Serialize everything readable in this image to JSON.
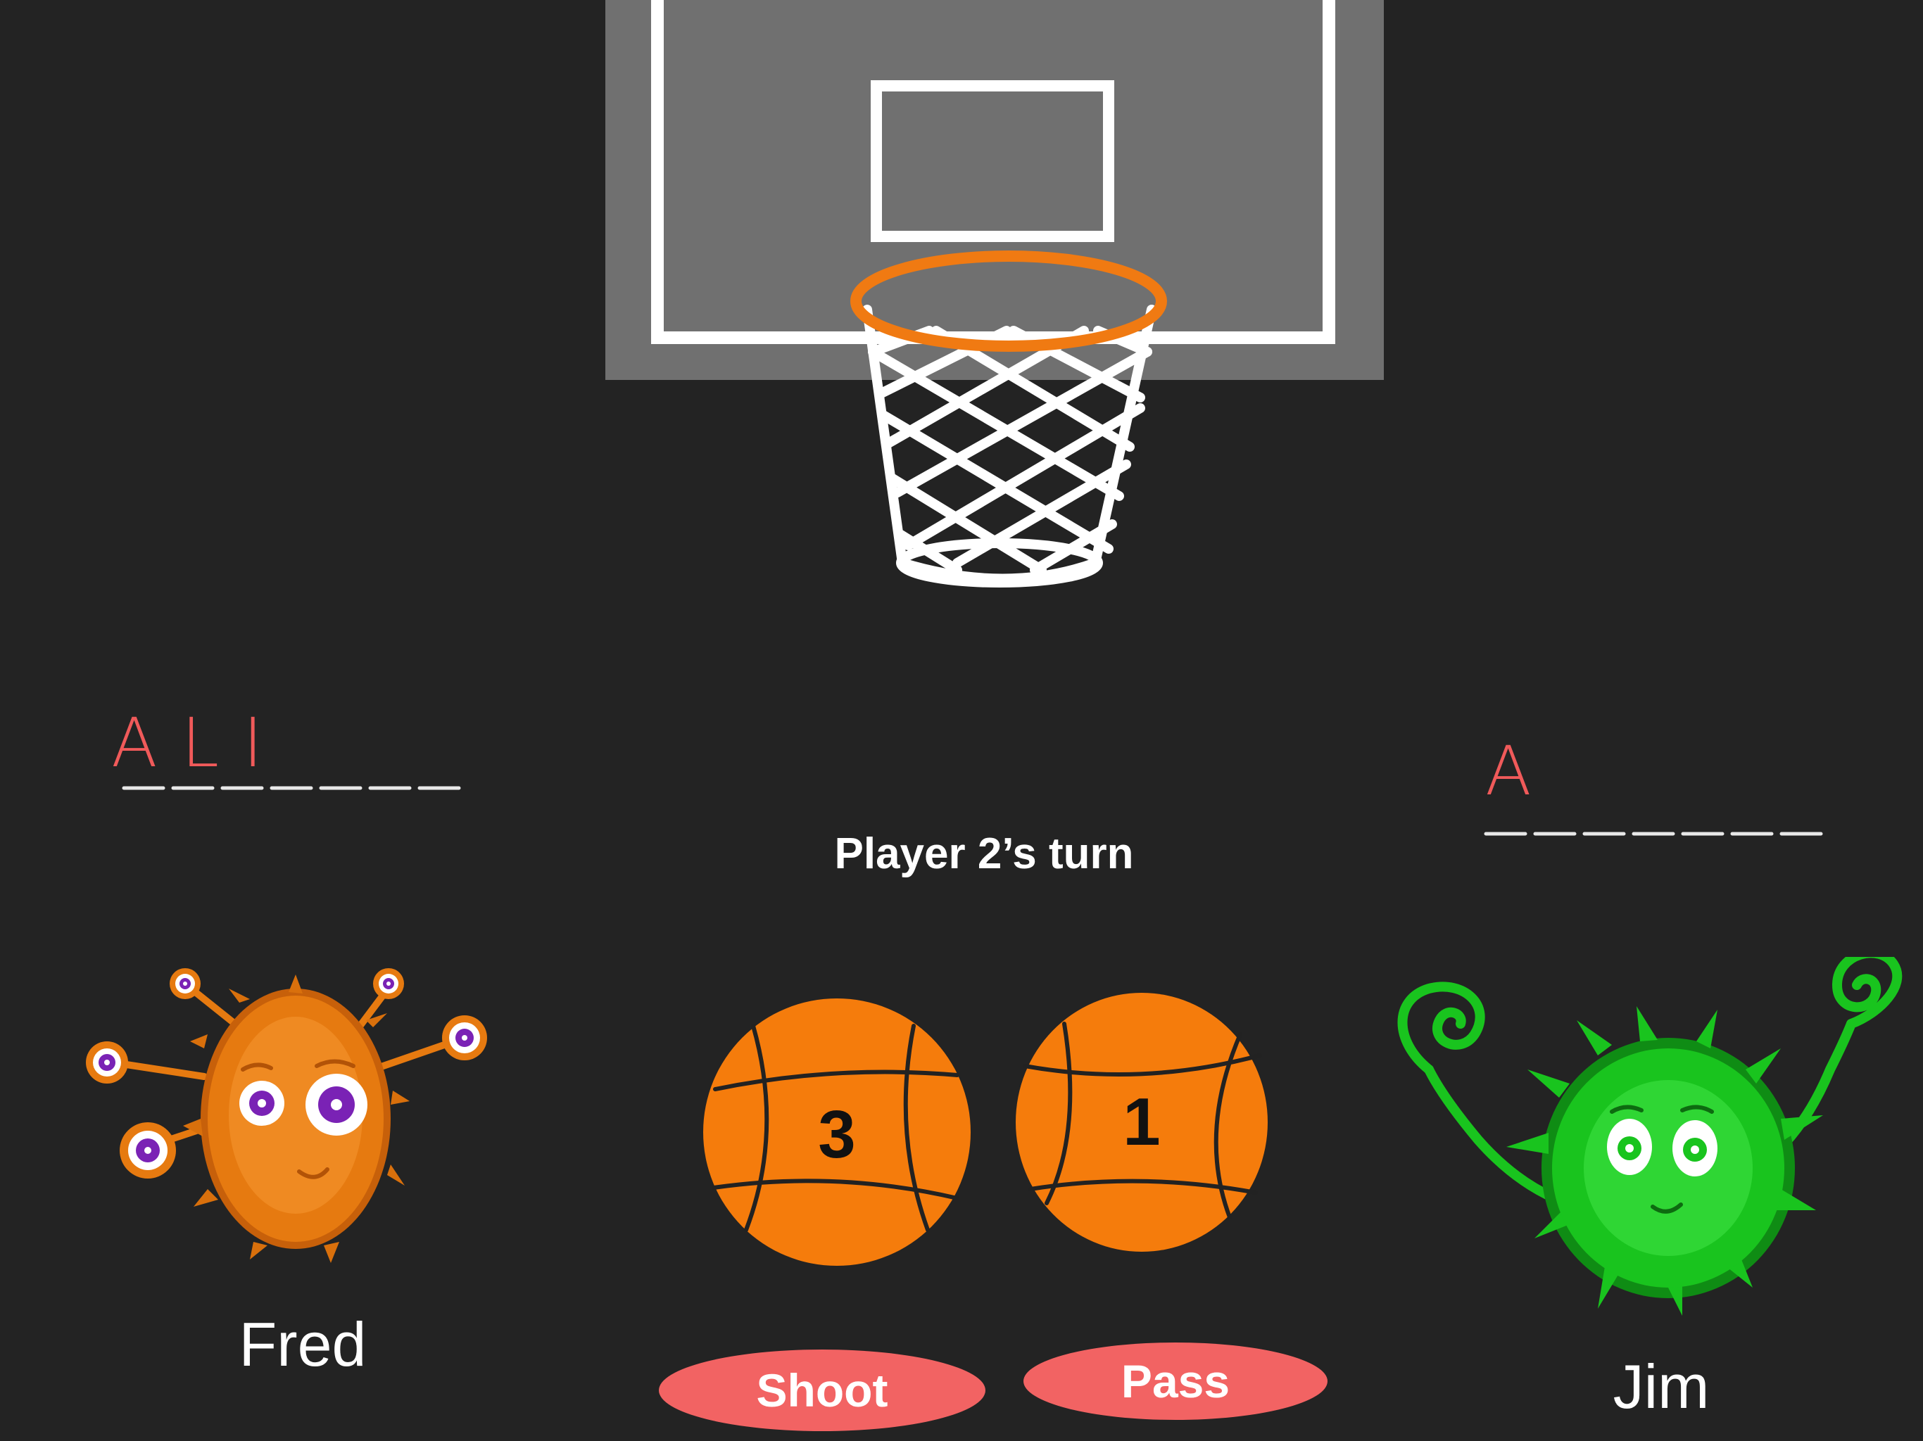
{
  "status": {
    "turn_text": "Player 2’s turn"
  },
  "players": [
    {
      "name": "Fred",
      "guess_letters": "ALI",
      "color": "#e67a10"
    },
    {
      "name": "Jim",
      "guess_letters": "A",
      "color": "#19c41e"
    }
  ],
  "balls": [
    {
      "value": "3"
    },
    {
      "value": "1"
    }
  ],
  "actions": {
    "shoot_label": "Shoot",
    "pass_label": "Pass"
  },
  "colors": {
    "background": "#232323",
    "backboard": "#707070",
    "rim": "#f07a12",
    "ball": "#f57c0c",
    "button": "#f26363",
    "handwriting": "#f05a5a"
  }
}
